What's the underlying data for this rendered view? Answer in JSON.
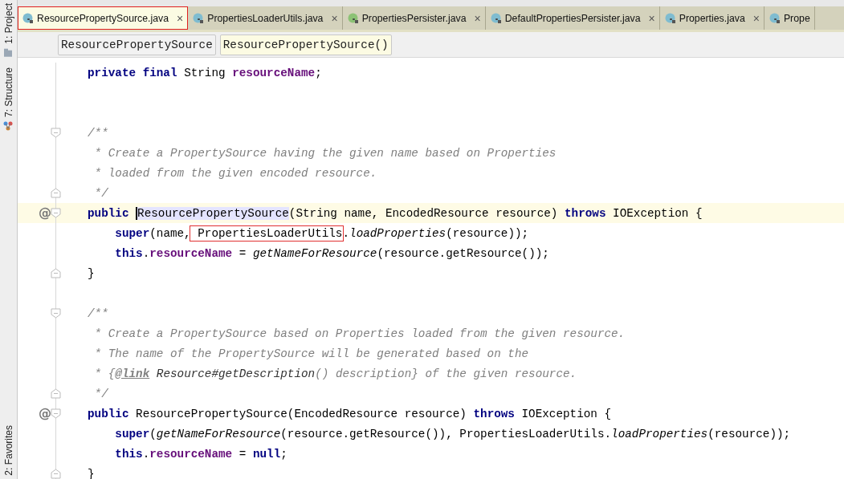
{
  "tool_strip": [
    {
      "label": "1: Project",
      "kind": "project"
    },
    {
      "label": "7: Structure",
      "kind": "structure"
    },
    {
      "label": "2: Favorites",
      "kind": "favorites"
    }
  ],
  "tabs": [
    {
      "label": "ResourcePropertySource.java",
      "kind": "class",
      "selected": true,
      "marked": true,
      "close": "×"
    },
    {
      "label": "PropertiesLoaderUtils.java",
      "kind": "class",
      "selected": false,
      "marked": false,
      "close": "×"
    },
    {
      "label": "PropertiesPersister.java",
      "kind": "interface",
      "selected": false,
      "marked": false,
      "close": "×"
    },
    {
      "label": "DefaultPropertiesPersister.java",
      "kind": "class",
      "selected": false,
      "marked": false,
      "close": "×"
    },
    {
      "label": "Properties.java",
      "kind": "class",
      "selected": false,
      "marked": false,
      "close": "×"
    },
    {
      "label": "Prope",
      "kind": "class",
      "selected": false,
      "marked": false
    }
  ],
  "breadcrumbs": [
    {
      "label": "ResourcePropertySource",
      "selected": false
    },
    {
      "label": "ResourcePropertySource()",
      "selected": true
    }
  ],
  "code_lines": [
    {
      "kind": "code",
      "fold_start": false,
      "fold_end": false,
      "current": false,
      "tokens": [
        {
          "text": "private final ",
          "kind": "kw"
        },
        {
          "text": "String ",
          "kind": "plain"
        },
        {
          "text": "resourceName",
          "kind": "field"
        },
        {
          "text": ";",
          "kind": "plain"
        }
      ]
    },
    {
      "kind": "blank",
      "fold_start": false,
      "fold_end": false,
      "current": false
    },
    {
      "kind": "blank",
      "fold_start": false,
      "fold_end": false,
      "current": false
    },
    {
      "kind": "code",
      "fold_start": true,
      "fold_end": false,
      "current": false,
      "tokens": [
        {
          "text": "/**",
          "kind": "comment"
        }
      ]
    },
    {
      "kind": "code",
      "fold_start": false,
      "fold_end": false,
      "current": false,
      "tokens": [
        {
          "text": " * Create a PropertySource having the given name based on Properties",
          "kind": "comment"
        }
      ]
    },
    {
      "kind": "code",
      "fold_start": false,
      "fold_end": false,
      "current": false,
      "tokens": [
        {
          "text": " * loaded from the given encoded resource.",
          "kind": "comment"
        }
      ]
    },
    {
      "kind": "code",
      "fold_start": false,
      "fold_end": true,
      "current": false,
      "tokens": [
        {
          "text": " */",
          "kind": "comment"
        }
      ]
    },
    {
      "kind": "code",
      "gutter": "@",
      "fold_start": true,
      "fold_end": false,
      "current": true,
      "tokens": [
        {
          "text": "public ",
          "kind": "kw"
        },
        {
          "text": "ResourcePropertySource",
          "kind": "decl"
        },
        {
          "text": "(String name, EncodedResource resource) ",
          "kind": "plain"
        },
        {
          "text": "throws ",
          "kind": "kw"
        },
        {
          "text": "IOException {",
          "kind": "plain"
        }
      ]
    },
    {
      "kind": "code",
      "fold_start": false,
      "fold_end": false,
      "current": false,
      "tokens": [
        {
          "text": "    super",
          "kind": "kw"
        },
        {
          "text": "(name,",
          "kind": "plain"
        },
        {
          "text": " PropertiesLoaderUtils",
          "kind": "boxed"
        },
        {
          "text": ".",
          "kind": "plain"
        },
        {
          "text": "loadProperties",
          "kind": "static"
        },
        {
          "text": "(resource));",
          "kind": "plain"
        }
      ]
    },
    {
      "kind": "code",
      "fold_start": false,
      "fold_end": false,
      "current": false,
      "tokens": [
        {
          "text": "    this",
          "kind": "kw"
        },
        {
          "text": ".",
          "kind": "plain"
        },
        {
          "text": "resourceName",
          "kind": "field"
        },
        {
          "text": " = ",
          "kind": "plain"
        },
        {
          "text": "getNameForResource",
          "kind": "static"
        },
        {
          "text": "(resource.getResource());",
          "kind": "plain"
        }
      ]
    },
    {
      "kind": "code",
      "fold_start": false,
      "fold_end": true,
      "current": false,
      "tokens": [
        {
          "text": "}",
          "kind": "plain"
        }
      ]
    },
    {
      "kind": "blank",
      "fold_start": false,
      "fold_end": false,
      "current": false
    },
    {
      "kind": "code",
      "fold_start": true,
      "fold_end": false,
      "current": false,
      "tokens": [
        {
          "text": "/**",
          "kind": "comment"
        }
      ]
    },
    {
      "kind": "code",
      "fold_start": false,
      "fold_end": false,
      "current": false,
      "tokens": [
        {
          "text": " * Create a PropertySource based on Properties loaded from the given resource.",
          "kind": "comment"
        }
      ]
    },
    {
      "kind": "code",
      "fold_start": false,
      "fold_end": false,
      "current": false,
      "tokens": [
        {
          "text": " * The name of the PropertySource will be generated based on the",
          "kind": "comment"
        }
      ]
    },
    {
      "kind": "code",
      "fold_start": false,
      "fold_end": false,
      "current": false,
      "tokens": [
        {
          "text": " * {",
          "kind": "comment"
        },
        {
          "text": "@link",
          "kind": "doctag"
        },
        {
          "text": " Resource#getDescription",
          "kind": "docref"
        },
        {
          "text": "() description} of the given resource.",
          "kind": "comment"
        }
      ]
    },
    {
      "kind": "code",
      "fold_start": false,
      "fold_end": true,
      "current": false,
      "tokens": [
        {
          "text": " */",
          "kind": "comment"
        }
      ]
    },
    {
      "kind": "code",
      "gutter": "@",
      "fold_start": true,
      "fold_end": false,
      "current": false,
      "tokens": [
        {
          "text": "public ",
          "kind": "kw"
        },
        {
          "text": "ResourcePropertySource(EncodedResource resource) ",
          "kind": "plain"
        },
        {
          "text": "throws ",
          "kind": "kw"
        },
        {
          "text": "IOException {",
          "kind": "plain"
        }
      ]
    },
    {
      "kind": "code",
      "fold_start": false,
      "fold_end": false,
      "current": false,
      "tokens": [
        {
          "text": "    super",
          "kind": "kw"
        },
        {
          "text": "(",
          "kind": "plain"
        },
        {
          "text": "getNameForResource",
          "kind": "static"
        },
        {
          "text": "(resource.getResource()), PropertiesLoaderUtils.",
          "kind": "plain"
        },
        {
          "text": "loadProperties",
          "kind": "static"
        },
        {
          "text": "(resource));",
          "kind": "plain"
        }
      ]
    },
    {
      "kind": "code",
      "fold_start": false,
      "fold_end": false,
      "current": false,
      "tokens": [
        {
          "text": "    this",
          "kind": "kw"
        },
        {
          "text": ".",
          "kind": "plain"
        },
        {
          "text": "resourceName",
          "kind": "field"
        },
        {
          "text": " = ",
          "kind": "plain"
        },
        {
          "text": "null",
          "kind": "kw"
        },
        {
          "text": ";",
          "kind": "plain"
        }
      ]
    },
    {
      "kind": "code",
      "fold_start": false,
      "fold_end": true,
      "current": false,
      "tokens": [
        {
          "text": "}",
          "kind": "plain"
        }
      ]
    }
  ]
}
